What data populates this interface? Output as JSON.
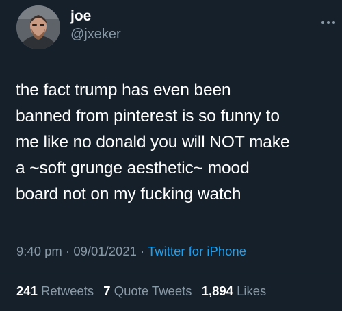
{
  "user": {
    "display_name": "joe",
    "handle": "@jxeker"
  },
  "tweet": {
    "text": "the fact trump has even been\nbanned from pinterest is so funny to\nme like no donald you will NOT make\na ~soft grunge aesthetic~ mood\nboard not on my fucking watch",
    "time": "9:40 pm",
    "date": "09/01/2021",
    "separator": "·",
    "source": "Twitter for iPhone"
  },
  "stats": {
    "retweets_count": "241",
    "retweets_label": "Retweets",
    "quotes_count": "7",
    "quotes_label": "Quote Tweets",
    "likes_count": "1,894",
    "likes_label": "Likes"
  },
  "colors": {
    "background": "#15202b",
    "text": "#ffffff",
    "muted": "#8899a6",
    "accent": "#1da1f2",
    "divider": "#38444d"
  },
  "icons": {
    "more": "more-horizontal-icon"
  }
}
